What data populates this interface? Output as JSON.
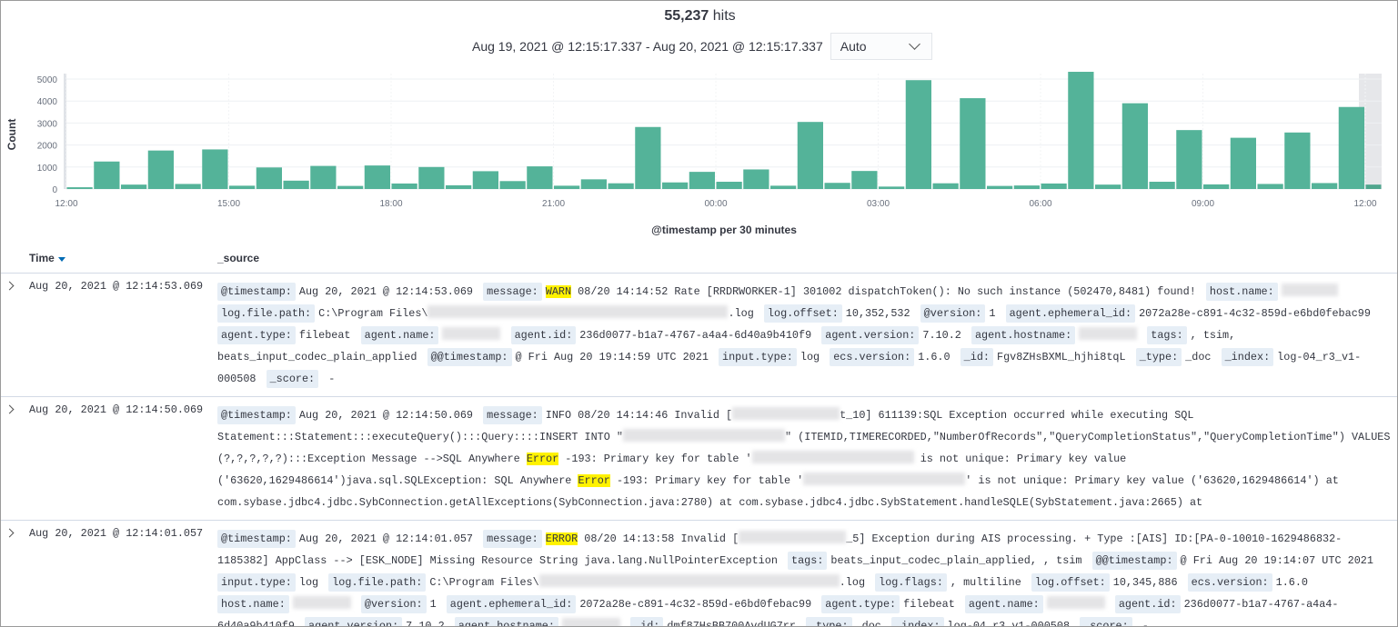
{
  "header": {
    "hits_count": "55,237",
    "hits_label": "hits",
    "time_range": "Aug 19, 2021 @ 12:15:17.337 - Aug 20, 2021 @ 12:15:17.337",
    "interval": "Auto"
  },
  "chart_data": {
    "type": "bar",
    "ylabel": "Count",
    "xlabel": "@timestamp per 30 minutes",
    "ylim": [
      0,
      5300
    ],
    "yticks": [
      "0",
      "1000",
      "2000",
      "3000",
      "4000",
      "5000"
    ],
    "xticks": [
      "12:00",
      "15:00",
      "18:00",
      "21:00",
      "00:00",
      "03:00",
      "06:00",
      "09:00",
      "12:00"
    ],
    "bar_color": "#54b399",
    "grid": true,
    "values": [
      80,
      1250,
      200,
      1750,
      230,
      1800,
      150,
      980,
      380,
      1050,
      140,
      1070,
      250,
      1000,
      170,
      810,
      360,
      1030,
      150,
      440,
      260,
      2820,
      300,
      780,
      330,
      890,
      150,
      3050,
      280,
      820,
      110,
      4950,
      260,
      4130,
      140,
      160,
      250,
      5330,
      200,
      3900,
      330,
      2680,
      210,
      2330,
      230,
      2570,
      270,
      3730,
      200
    ]
  },
  "table": {
    "col_time": "Time",
    "col_source": "_source",
    "rows": [
      {
        "time": "Aug 20, 2021 @ 12:14:53.069",
        "fields": [
          {
            "k": "@timestamp:",
            "v": [
              "Aug 20, 2021 @ 12:14:53.069"
            ]
          },
          {
            "k": "message:",
            "v": [
              {
                "hl": "WARN"
              },
              " 08/20 14:14:52 Rate [RRDRWORKER-1] 301002 dispatchToken(): No such instance (502470,8481) found!"
            ]
          },
          {
            "k": "host.name:",
            "v": [
              {
                "redacted": "host"
              }
            ]
          },
          {
            "k": "log.file.path:",
            "v": [
              "C:\\Program Files\\",
              {
                "redacted": "path"
              },
              ".log"
            ]
          },
          {
            "k": "log.offset:",
            "v": [
              "10,352,532"
            ]
          },
          {
            "k": "@version:",
            "v": [
              "1"
            ]
          },
          {
            "k": "agent.ephemeral_id:",
            "v": [
              "2072a28e-c891-4c32-859d-e6bd0febac99"
            ]
          },
          {
            "k": "agent.type:",
            "v": [
              "filebeat"
            ]
          },
          {
            "k": "agent.name:",
            "v": [
              {
                "redacted": "name"
              }
            ]
          },
          {
            "k": "agent.id:",
            "v": [
              "236d0077-b1a7-4767-a4a4-6d40a9b410f9"
            ]
          },
          {
            "k": "agent.version:",
            "v": [
              "7.10.2"
            ]
          },
          {
            "k": "agent.hostname:",
            "v": [
              {
                "redacted": "name"
              }
            ]
          },
          {
            "k": "tags:",
            "v": [
              ", tsim, beats_input_codec_plain_applied"
            ]
          },
          {
            "k": "@@timestamp:",
            "v": [
              "@ Fri Aug 20 19:14:59 UTC 2021"
            ]
          },
          {
            "k": "input.type:",
            "v": [
              "log"
            ]
          },
          {
            "k": "ecs.version:",
            "v": [
              "1.6.0"
            ]
          },
          {
            "k": "_id:",
            "v": [
              "Fgv8ZHsBXML_hjhi8tqL"
            ]
          },
          {
            "k": "_type:",
            "v": [
              "_doc"
            ]
          },
          {
            "k": "_index:",
            "v": [
              "log-04_r3_v1-000508"
            ]
          },
          {
            "k": "_score:",
            "v": [
              " -"
            ]
          }
        ]
      },
      {
        "time": "Aug 20, 2021 @ 12:14:50.069",
        "fields": [
          {
            "k": "@timestamp:",
            "v": [
              "Aug 20, 2021 @ 12:14:50.069"
            ]
          },
          {
            "k": "message:",
            "v": [
              "INFO 08/20 14:14:46 Invalid [",
              {
                "redacted": "mid"
              },
              "t_10] 611139:SQL Exception occurred while executing SQL Statement:::Statement:::executeQuery():::Query::::INSERT INTO \"",
              {
                "redacted": "table"
              },
              "\" (ITEMID,TIMERECORDED,\"NumberOfRecords\",\"QueryCompletionStatus\",\"QueryCompletionTime\") VALUES (?,?,?,?,?):::Exception Message -->SQL Anywhere ",
              {
                "hl": "Error"
              },
              " -193: Primary key for table '",
              {
                "redacted": "table"
              },
              " is not unique: Primary key value ('63620,1629486614')java.sql.SQLException: SQL Anywhere ",
              {
                "hl": "Error"
              },
              " -193: Primary key for table '",
              {
                "redacted": "table"
              },
              "' is not unique: Primary key value ('63620,1629486614') at com.sybase.jdbc4.jdbc.SybConnection.getAllExceptions(SybConnection.java:2780) at com.sybase.jdbc4.jdbc.SybStatement.handleSQLE(SybStatement.java:2665) at"
            ]
          }
        ]
      },
      {
        "time": "Aug 20, 2021 @ 12:14:01.057",
        "fields": [
          {
            "k": "@timestamp:",
            "v": [
              "Aug 20, 2021 @ 12:14:01.057"
            ]
          },
          {
            "k": "message:",
            "v": [
              {
                "hl": "ERROR"
              },
              " 08/20 14:13:58 Invalid [",
              {
                "redacted": "mid"
              },
              "_5] Exception during AIS processing. + Type :[AIS] ID:[PA-0-10010-1629486832-1185382] AppClass --> [ESK_NODE] Missing Resource String java.lang.NullPointerException"
            ]
          },
          {
            "k": "tags:",
            "v": [
              "beats_input_codec_plain_applied, , tsim"
            ]
          },
          {
            "k": "@@timestamp:",
            "v": [
              "@ Fri Aug 20 19:14:07 UTC 2021"
            ]
          },
          {
            "k": "input.type:",
            "v": [
              "log"
            ]
          },
          {
            "k": "log.file.path:",
            "v": [
              "C:\\Program Files\\",
              {
                "redacted": "path"
              },
              ".log"
            ]
          },
          {
            "k": "log.flags:",
            "v": [
              ", multiline"
            ]
          },
          {
            "k": "log.offset:",
            "v": [
              "10,345,886"
            ]
          },
          {
            "k": "ecs.version:",
            "v": [
              "1.6.0"
            ]
          },
          {
            "k": "host.name:",
            "v": [
              {
                "redacted": "name"
              }
            ]
          },
          {
            "k": "@version:",
            "v": [
              "1"
            ]
          },
          {
            "k": "agent.ephemeral_id:",
            "v": [
              "2072a28e-c891-4c32-859d-e6bd0febac99"
            ]
          },
          {
            "k": "agent.type:",
            "v": [
              "filebeat"
            ]
          },
          {
            "k": "agent.name:",
            "v": [
              {
                "redacted": "name"
              }
            ]
          },
          {
            "k": "agent.id:",
            "v": [
              "236d0077-b1a7-4767-a4a4-6d40a9b410f9"
            ]
          },
          {
            "k": "agent.version:",
            "v": [
              "7.10.2"
            ]
          },
          {
            "k": "agent.hostname:",
            "v": [
              {
                "redacted": "name"
              }
            ]
          },
          {
            "k": "_id:",
            "v": [
              "dmf87HsBB700AvdUG7rr"
            ]
          },
          {
            "k": "_type:",
            "v": [
              "_doc"
            ]
          },
          {
            "k": "_index:",
            "v": [
              "log-04_r3_v1-000508"
            ]
          },
          {
            "k": "_score:",
            "v": [
              " -"
            ]
          }
        ]
      }
    ]
  }
}
